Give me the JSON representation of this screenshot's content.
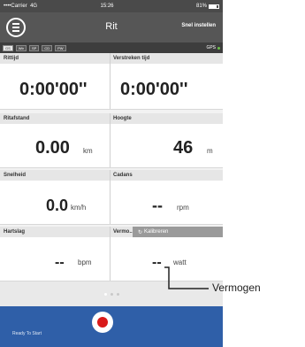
{
  "status": {
    "carrier": "••••Carrier",
    "network": "4G",
    "time": "15:26",
    "right": "81%"
  },
  "nav": {
    "title": "Rit",
    "setup": "Snel instellen"
  },
  "sensors": {
    "items": [
      "GS",
      "Wtr",
      "SP",
      "CD",
      "PW"
    ],
    "gps": "GPS"
  },
  "rows": [
    {
      "left_label": "Rittijd",
      "right_label": "Verstreken tijd",
      "left_value": "0:00'00''",
      "right_value": "0:00'00''"
    },
    {
      "left_label": "Ritafstand",
      "right_label": "Hoogte",
      "left_value": "0.00",
      "left_unit": "km",
      "right_value": "46",
      "right_unit": "m"
    },
    {
      "left_label": "Snelheid",
      "right_label": "Cadans",
      "left_value": "0.0",
      "left_unit": "km/h",
      "right_value": "--",
      "right_unit": "rpm"
    },
    {
      "left_label": "Hartslag",
      "right_label": "Vermo...",
      "calibrate": "Kalibreren",
      "left_value": "--",
      "left_unit": "bpm",
      "right_value": "--",
      "right_unit": "watt"
    }
  ],
  "bottom": {
    "ready": "Ready To Start"
  },
  "callout": {
    "label": "Vermogen"
  }
}
